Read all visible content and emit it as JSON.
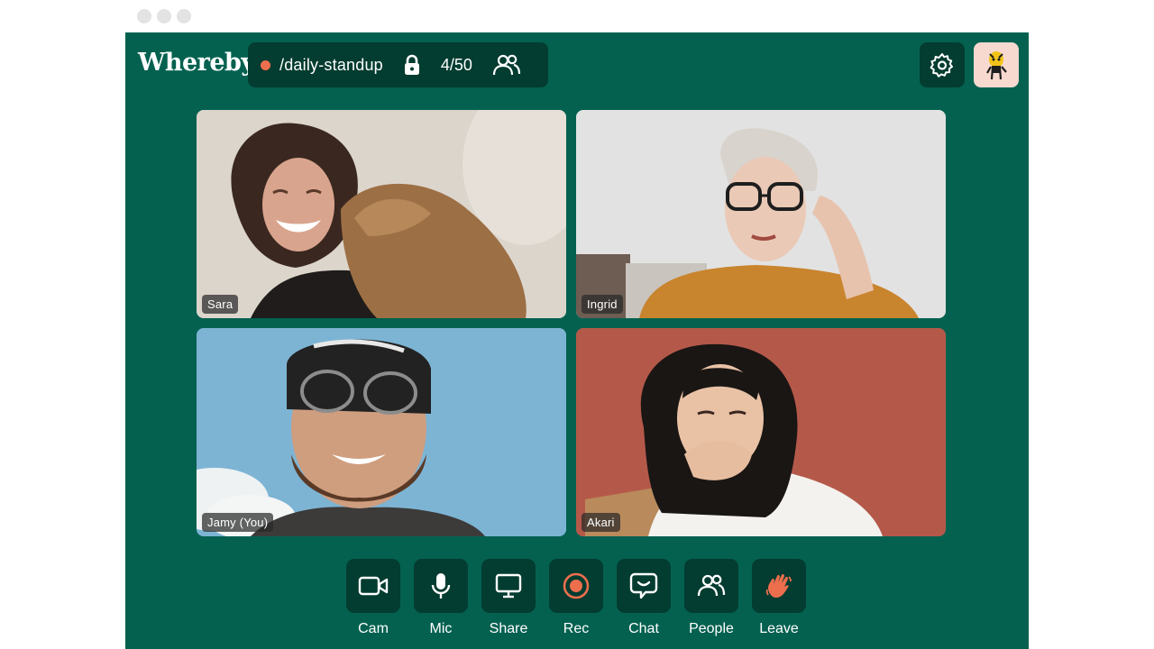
{
  "app": {
    "logo": "Whereby"
  },
  "room": {
    "name": "/daily-standup",
    "participant_count": "4/50",
    "recording_dot_color": "#ed6e4d",
    "locked": true
  },
  "header_icons": [
    "lock-icon",
    "people-icon",
    "gear-icon",
    "avatar"
  ],
  "participants": [
    {
      "name": "Sara"
    },
    {
      "name": "Ingrid"
    },
    {
      "name": "Jamy (You)"
    },
    {
      "name": "Akari"
    }
  ],
  "toolbar": {
    "cam": {
      "label": "Cam",
      "icon": "camera-icon"
    },
    "mic": {
      "label": "Mic",
      "icon": "microphone-icon"
    },
    "share": {
      "label": "Share",
      "icon": "screen-share-icon"
    },
    "rec": {
      "label": "Rec",
      "icon": "record-icon"
    },
    "chat": {
      "label": "Chat",
      "icon": "chat-icon"
    },
    "people": {
      "label": "People",
      "icon": "people-icon"
    },
    "leave": {
      "label": "Leave",
      "icon": "wave-hand-icon"
    }
  },
  "colors": {
    "background": "#046150",
    "button": "#033c30",
    "accent": "#ed6e4d",
    "avatar_bg": "#f8d9cf"
  }
}
